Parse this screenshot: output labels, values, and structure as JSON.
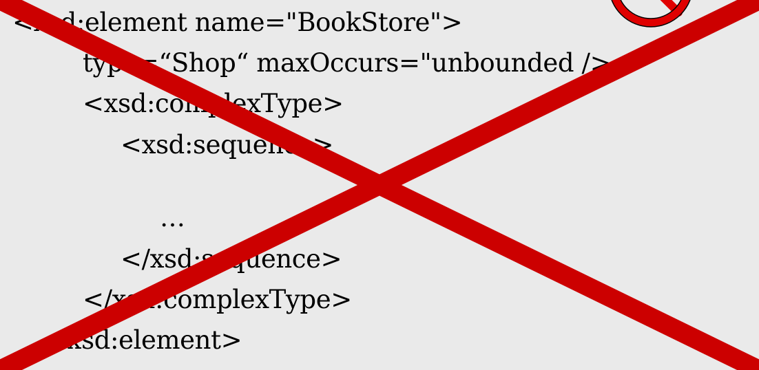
{
  "code": {
    "lines": [
      "<xsd:element name=\"BookStore\">",
      "type=“Shop“ maxOccurs=\"unbounded />",
      "<xsd:complexType>",
      "<xsd:sequence>",
      "…",
      "</xsd:sequence>",
      "</xsd:complexType>",
      "</xsd:element>"
    ]
  },
  "overlay": {
    "cross_color": "#cc0000",
    "no_sign_color": "#e00000",
    "no_sign_icon": "no-entry-icon"
  }
}
